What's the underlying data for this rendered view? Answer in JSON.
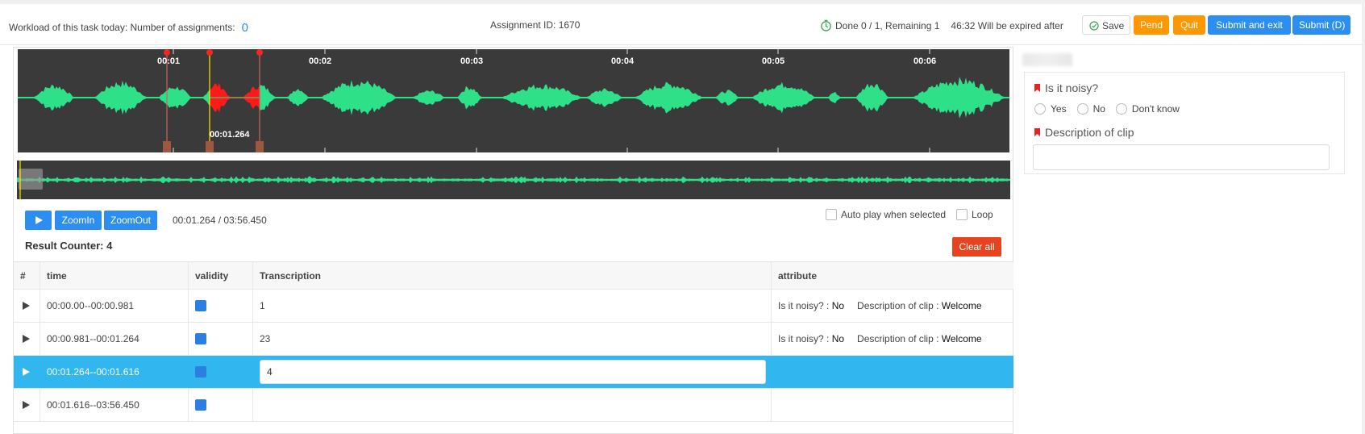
{
  "header": {
    "workload_label": "Workload of this task today: Number of assignments:",
    "workload_count": "0",
    "assignment_id": "Assignment ID: 1670",
    "progress": "Done 0 / 1, Remaining 1",
    "expiry": "46:32 Will be expired after",
    "buttons": {
      "save": "Save",
      "pend": "Pend",
      "quit": "Quit",
      "submit_exit": "Submit and exit",
      "submit": "Submit (D)"
    }
  },
  "waveform": {
    "ticks": [
      "00:01",
      "00:02",
      "00:03",
      "00:04",
      "00:05",
      "00:06"
    ],
    "cursor_time": "00:01.264",
    "colors": {
      "wave": "#2ee087",
      "selected": "#ff1a1a",
      "background": "#3a3a3a",
      "cursor": "#ffe600"
    }
  },
  "controls": {
    "zoom_in": "ZoomIn",
    "zoom_out": "ZoomOut",
    "time": "00:01.264 / 03:56.450",
    "auto_play": "Auto play when selected",
    "loop": "Loop",
    "result_counter": "Result Counter: 4",
    "clear_all": "Clear all"
  },
  "table": {
    "headers": [
      "#",
      "time",
      "validity",
      "Transcription",
      "attribute"
    ],
    "rows": [
      {
        "time": "00:00.00--00:00.981",
        "transcription": "1",
        "attr_noisy_label": "Is it noisy? :",
        "attr_noisy": "No",
        "attr_desc_label": "Description of clip :",
        "attr_desc": "Welcome",
        "selected": false
      },
      {
        "time": "00:00.981--00:01.264",
        "transcription": "23",
        "attr_noisy_label": "Is it noisy? :",
        "attr_noisy": "No",
        "attr_desc_label": "Description of clip :",
        "attr_desc": "Welcome",
        "selected": false
      },
      {
        "time": "00:01.264--00:01.616",
        "transcription": "4",
        "selected": true
      },
      {
        "time": "00:01.616--03:56.450",
        "transcription": "",
        "selected": false
      }
    ]
  },
  "form": {
    "q1": "Is it noisy?",
    "options": [
      "Yes",
      "No",
      "Don't know"
    ],
    "q2": "Description of clip"
  }
}
